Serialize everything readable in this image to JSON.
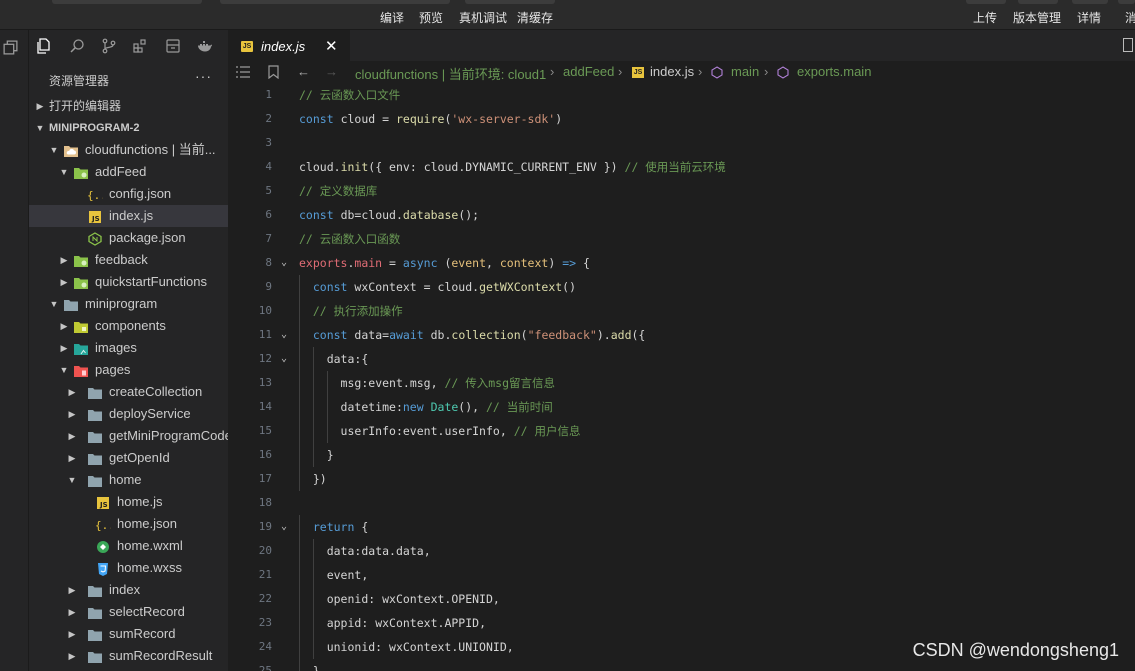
{
  "toolbar": {
    "compile": "编译",
    "preview": "预览",
    "remote_debug": "真机调试",
    "clear_cache": "清缓存",
    "upload": "上传",
    "version_manage": "版本管理",
    "details": "详情",
    "message": "消"
  },
  "sidebar": {
    "title": "资源管理器",
    "more": "···",
    "open_editors": "打开的编辑器",
    "project": "MINIPROGRAM-2",
    "tree": [
      {
        "label": "cloudfunctions | 当前...",
        "depth": 1,
        "type": "folder-cloud",
        "open": true
      },
      {
        "label": "addFeed",
        "depth": 2,
        "type": "folder-green",
        "open": true
      },
      {
        "label": "config.json",
        "depth": 3,
        "type": "json"
      },
      {
        "label": "index.js",
        "depth": 3,
        "type": "js",
        "selected": true
      },
      {
        "label": "package.json",
        "depth": 3,
        "type": "npm"
      },
      {
        "label": "feedback",
        "depth": 2,
        "type": "folder-green",
        "open": false
      },
      {
        "label": "quickstartFunctions",
        "depth": 2,
        "type": "folder-green",
        "open": false
      },
      {
        "label": "miniprogram",
        "depth": 1,
        "type": "folder-grey",
        "open": true
      },
      {
        "label": "components",
        "depth": 2,
        "type": "folder-comp",
        "open": false
      },
      {
        "label": "images",
        "depth": 2,
        "type": "folder-img",
        "open": false
      },
      {
        "label": "pages",
        "depth": 2,
        "type": "folder-pages",
        "open": true
      },
      {
        "label": "createCollection",
        "depth": 3,
        "type": "folder-grey",
        "open": false
      },
      {
        "label": "deployService",
        "depth": 3,
        "type": "folder-grey",
        "open": false
      },
      {
        "label": "getMiniProgramCode",
        "depth": 3,
        "type": "folder-grey",
        "open": false
      },
      {
        "label": "getOpenId",
        "depth": 3,
        "type": "folder-grey",
        "open": false
      },
      {
        "label": "home",
        "depth": 3,
        "type": "folder-grey",
        "open": true
      },
      {
        "label": "home.js",
        "depth": 4,
        "type": "js"
      },
      {
        "label": "home.json",
        "depth": 4,
        "type": "json"
      },
      {
        "label": "home.wxml",
        "depth": 4,
        "type": "wxml"
      },
      {
        "label": "home.wxss",
        "depth": 4,
        "type": "wxss"
      },
      {
        "label": "index",
        "depth": 3,
        "type": "folder-grey",
        "open": false
      },
      {
        "label": "selectRecord",
        "depth": 3,
        "type": "folder-grey",
        "open": false
      },
      {
        "label": "sumRecord",
        "depth": 3,
        "type": "folder-grey",
        "open": false
      },
      {
        "label": "sumRecordResult",
        "depth": 3,
        "type": "folder-grey",
        "open": false
      }
    ]
  },
  "editor": {
    "tab_label": "index.js",
    "tab_badge": "JS",
    "breadcrumb": [
      "cloudfunctions | 当前环境: cloud1",
      "addFeed",
      "index.js",
      "main",
      "exports.main"
    ],
    "lines": [
      {
        "n": "1",
        "t": "// 云函数入口文件"
      },
      {
        "n": "2",
        "t": "const cloud = require('wx-server-sdk')"
      },
      {
        "n": "3",
        "t": ""
      },
      {
        "n": "4",
        "t": "cloud.init({ env: cloud.DYNAMIC_CURRENT_ENV }) // 使用当前云环境"
      },
      {
        "n": "5",
        "t": "// 定义数据库"
      },
      {
        "n": "6",
        "t": "const db=cloud.database();"
      },
      {
        "n": "7",
        "t": "// 云函数入口函数"
      },
      {
        "n": "8",
        "t": "exports.main = async (event, context) => {"
      },
      {
        "n": "9",
        "t": "  const wxContext = cloud.getWXContext()"
      },
      {
        "n": "10",
        "t": "  // 执行添加操作"
      },
      {
        "n": "11",
        "t": "  const data=await db.collection(\"feedback\").add({"
      },
      {
        "n": "12",
        "t": "    data:{"
      },
      {
        "n": "13",
        "t": "      msg:event.msg, // 传入msg留言信息"
      },
      {
        "n": "14",
        "t": "      datetime:new Date(), // 当前时间"
      },
      {
        "n": "15",
        "t": "      userInfo:event.userInfo, // 用户信息"
      },
      {
        "n": "16",
        "t": "    }"
      },
      {
        "n": "17",
        "t": "  })"
      },
      {
        "n": "18",
        "t": ""
      },
      {
        "n": "19",
        "t": "  return {"
      },
      {
        "n": "20",
        "t": "    data:data.data,"
      },
      {
        "n": "21",
        "t": "    event,"
      },
      {
        "n": "22",
        "t": "    openid: wxContext.OPENID,"
      },
      {
        "n": "23",
        "t": "    appid: wxContext.APPID,"
      },
      {
        "n": "24",
        "t": "    unionid: wxContext.UNIONID,"
      },
      {
        "n": "25",
        "t": "  }"
      }
    ]
  },
  "watermark": "CSDN @wendongsheng1"
}
